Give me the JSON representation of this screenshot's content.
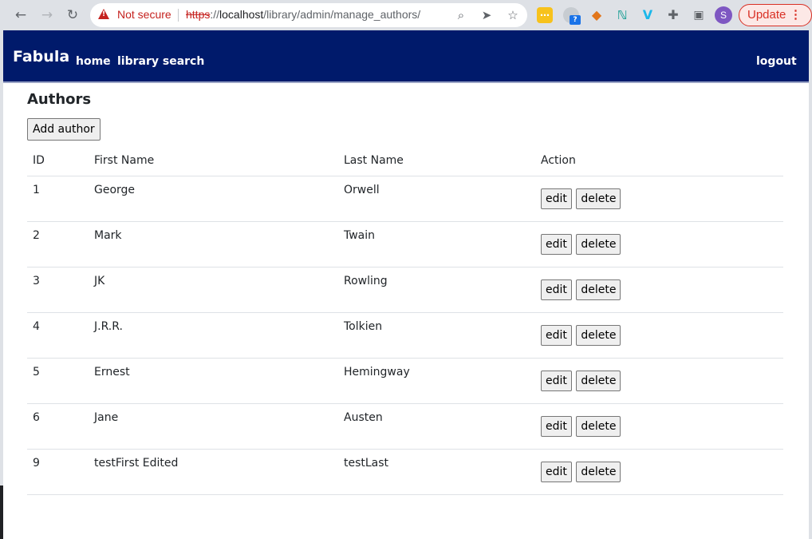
{
  "browser": {
    "security_label": "Not secure",
    "url_scheme": "https",
    "url_sep": "://",
    "url_host": "localhost",
    "url_path": "/library/admin/manage_authors/",
    "profile_initial": "S",
    "update_label": "Update",
    "ext_badge": "?"
  },
  "navbar": {
    "brand": "Fabula",
    "links": {
      "home": "home",
      "search": "library search",
      "logout": "logout"
    }
  },
  "main": {
    "title": "Authors",
    "add_button": "Add author",
    "table": {
      "headers": {
        "id": "ID",
        "first": "First Name",
        "last": "Last Name",
        "action": "Action"
      },
      "rows": [
        {
          "id": "1",
          "first": "George",
          "last": "Orwell"
        },
        {
          "id": "2",
          "first": "Mark",
          "last": "Twain"
        },
        {
          "id": "3",
          "first": "JK",
          "last": "Rowling"
        },
        {
          "id": "4",
          "first": "J.R.R.",
          "last": "Tolkien"
        },
        {
          "id": "5",
          "first": "Ernest",
          "last": "Hemingway"
        },
        {
          "id": "6",
          "first": "Jane",
          "last": "Austen"
        },
        {
          "id": "9",
          "first": "testFirst Edited",
          "last": "testLast"
        }
      ],
      "edit_label": "edit",
      "delete_label": "delete"
    }
  }
}
